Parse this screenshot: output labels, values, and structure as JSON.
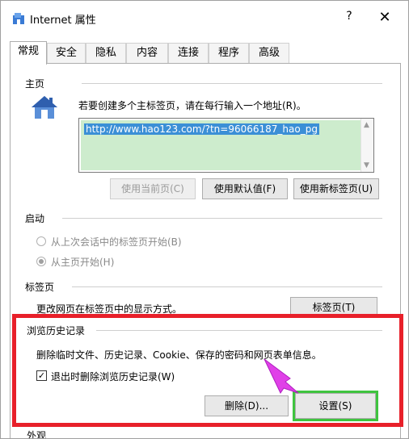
{
  "window": {
    "title": "Internet 属性",
    "help": "?",
    "close": "✕"
  },
  "tabs": [
    "常规",
    "安全",
    "隐私",
    "内容",
    "连接",
    "程序",
    "高级"
  ],
  "home": {
    "group_label": "主页",
    "instruction": "若要创建多个主标签页，请在每行输入一个地址(R)。",
    "url": "http://www.hao123.com/?tn=96066187_hao_pg",
    "btn_current": "使用当前页(C)",
    "btn_default": "使用默认值(F)",
    "btn_newtab": "使用新标签页(U)"
  },
  "startup": {
    "group_label": "启动",
    "option_last": "从上次会话中的标签页开始(B)",
    "option_home": "从主页开始(H)"
  },
  "tabs_section": {
    "group_label": "标签页",
    "description": "更改网页在标签页中的显示方式。",
    "button": "标签页(T)"
  },
  "history": {
    "group_label": "浏览历史记录",
    "description": "删除临时文件、历史记录、Cookie、保存的密码和网页表单信息。",
    "checkbox_label": "退出时删除浏览历史记录(W)",
    "checkbox_checked": true,
    "btn_delete": "删除(D)...",
    "btn_settings": "设置(S)"
  },
  "next_section_partial": "外观",
  "colors": {
    "highlight_red": "#e8202a",
    "highlight_green": "#3fc43f",
    "arrow_magenta": "#e040e8",
    "url_selection": "#3b8fd6",
    "url_bg": "#cdeccd"
  }
}
